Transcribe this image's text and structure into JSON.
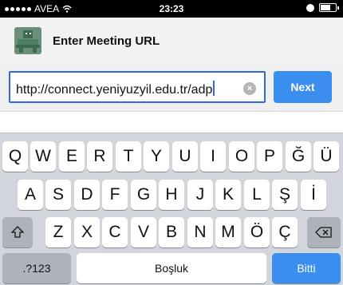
{
  "status_bar": {
    "carrier": "AVEA",
    "time": "23:23"
  },
  "header": {
    "title": "Enter Meeting URL",
    "app_icon": "meeting-app-icon"
  },
  "url_input": {
    "value": "http://connect.yeniyuzyil.edu.tr/adp",
    "clear_icon": "clear-icon"
  },
  "next_button": {
    "label": "Next"
  },
  "keyboard": {
    "row1": [
      "Q",
      "W",
      "E",
      "R",
      "T",
      "Y",
      "U",
      "I",
      "O",
      "P",
      "Ğ",
      "Ü"
    ],
    "row2": [
      "A",
      "S",
      "D",
      "F",
      "G",
      "H",
      "J",
      "K",
      "L",
      "Ş",
      "İ"
    ],
    "row3": [
      "Z",
      "X",
      "C",
      "V",
      "B",
      "N",
      "M",
      "Ö",
      "Ç"
    ],
    "shift_icon": "shift-icon",
    "delete_icon": "delete-icon",
    "numbers_label": ".?123",
    "space_label": "Boşluk",
    "done_label": "Bitti"
  },
  "colors": {
    "accent": "#3a8ef0",
    "keyboard_bg": "#d2d5db"
  }
}
